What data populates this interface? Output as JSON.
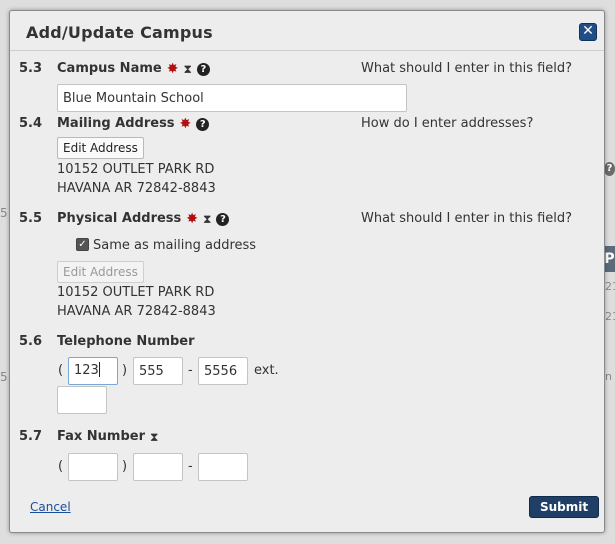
{
  "dialog": {
    "title": "Add/Update Campus",
    "close_label": "✕"
  },
  "campus_name": {
    "number": "5.3",
    "label": "Campus Name",
    "help_text": "What should I enter in this field?",
    "value": "Blue Mountain School"
  },
  "mailing_address": {
    "number": "5.4",
    "label": "Mailing Address",
    "help_text": "How do I enter addresses?",
    "edit_button": "Edit Address",
    "line1": "10152 OUTLET PARK RD",
    "line2": "HAVANA AR 72842-8843"
  },
  "physical_address": {
    "number": "5.5",
    "label": "Physical Address",
    "help_text": "What should I enter in this field?",
    "same_as_label": "Same as mailing address",
    "same_as_checked": true,
    "edit_button": "Edit Address",
    "line1": "10152 OUTLET PARK RD",
    "line2": "HAVANA AR 72842-8843"
  },
  "telephone": {
    "number": "5.6",
    "label": "Telephone Number",
    "area_code": "123",
    "prefix": "555",
    "line": "5556",
    "ext_label": "ext.",
    "ext_value": ""
  },
  "fax": {
    "number": "5.7",
    "label": "Fax Number",
    "area_code": "",
    "prefix": "",
    "line": ""
  },
  "footer": {
    "cancel_label": "Cancel",
    "submit_label": "Submit"
  },
  "colors": {
    "required": "#b40f0f",
    "primary": "#1f3f66",
    "link": "#1a4d9b"
  },
  "background": {
    "frag1": "5.",
    "frag2": "5.",
    "frag3": "?",
    "frag4": "P",
    "frag5": "21",
    "frag6": "21",
    "frag7": "n"
  }
}
